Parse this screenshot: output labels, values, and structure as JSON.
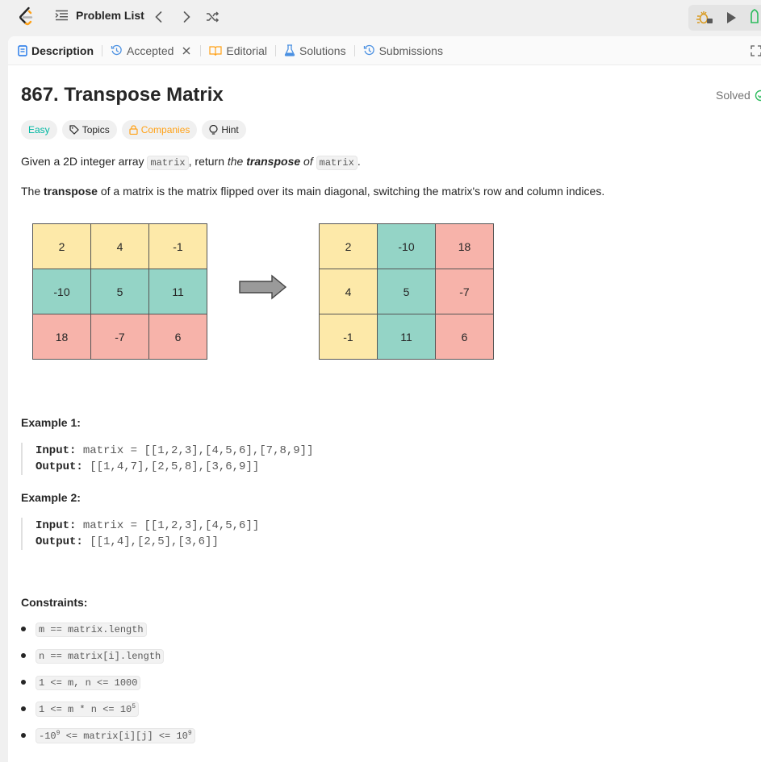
{
  "topbar": {
    "problem_list_label": "Problem List"
  },
  "tabs": [
    {
      "label": "Description"
    },
    {
      "label": "Accepted"
    },
    {
      "label": "Editorial"
    },
    {
      "label": "Solutions"
    },
    {
      "label": "Submissions"
    }
  ],
  "problem": {
    "title": "867. Transpose Matrix",
    "status": "Solved",
    "tags": {
      "difficulty": "Easy",
      "topics": "Topics",
      "companies": "Companies",
      "hint": "Hint"
    },
    "desc1": {
      "t1": "Given a 2D integer array ",
      "c1": "matrix",
      "t2": ", return ",
      "t3": "the ",
      "t4": "transpose",
      "t5": " of ",
      "c2": "matrix",
      "t6": "."
    },
    "desc2": {
      "t1": "The ",
      "t2": "transpose",
      "t3": " of a matrix is the matrix flipped over its main diagonal, switching the matrix's row and column indices."
    },
    "matrix_before": [
      [
        "2",
        "4",
        "-1"
      ],
      [
        "-10",
        "5",
        "11"
      ],
      [
        "18",
        "-7",
        "6"
      ]
    ],
    "matrix_after": [
      [
        "2",
        "-10",
        "18"
      ],
      [
        "4",
        "5",
        "-7"
      ],
      [
        "-1",
        "11",
        "6"
      ]
    ],
    "example1": {
      "heading": "Example 1:",
      "input_label": "Input:",
      "input": "matrix = [[1,2,3],[4,5,6],[7,8,9]]",
      "output_label": "Output:",
      "output": "[[1,4,7],[2,5,8],[3,6,9]]"
    },
    "example2": {
      "heading": "Example 2:",
      "input_label": "Input:",
      "input": "matrix = [[1,2,3],[4,5,6]]",
      "output_label": "Output:",
      "output": "[[1,4],[2,5],[3,6]]"
    },
    "constraints_heading": "Constraints:",
    "constraints": [
      {
        "text": "m == matrix.length"
      },
      {
        "text": "n == matrix[i].length"
      },
      {
        "text": "1 <= m, n <= 1000"
      },
      {
        "base": "1 <= m * n <= 10",
        "sup": "5"
      },
      {
        "pre": "-10",
        "sup1": "9",
        "mid": " <= matrix[i][j] <= 10",
        "sup2": "9"
      }
    ]
  },
  "colors": {
    "easy": "#00b8a3",
    "companies": "#ffa116",
    "solved": "#2cbb5d",
    "cell_yellow": "#fde9a9",
    "cell_green": "#94d4c6",
    "cell_red": "#f7b3aa"
  }
}
